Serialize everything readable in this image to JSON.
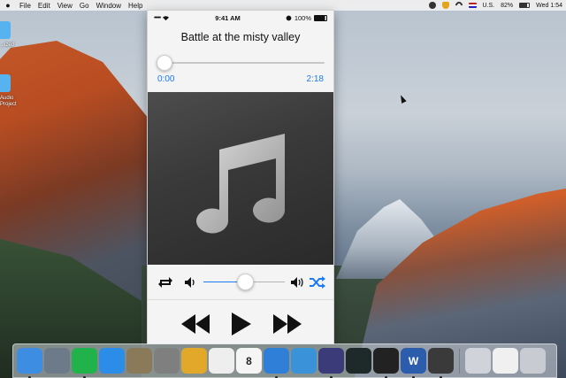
{
  "menubar": {
    "menus": [
      "File",
      "Edit",
      "View",
      "Go",
      "Window",
      "Help"
    ],
    "input_source": "U.S.",
    "battery": "82%",
    "clock": "Wed 1:54"
  },
  "desktop": {
    "icons": [
      {
        "label": "...ized",
        "icon": "folder-icon"
      },
      {
        "label": "Audio\nProject",
        "icon": "folder-icon"
      }
    ]
  },
  "simulator": {
    "status_bar": {
      "signal": "•••••",
      "time": "9:41 AM",
      "battery": "100%"
    },
    "song_title": "Battle at the misty valley",
    "current_time": "0:00",
    "duration": "2:18",
    "progress": 0.0,
    "volume": 0.55,
    "artwork_icon": "music-note-icon"
  },
  "colors": {
    "accent": "#1a7cf2",
    "artwork_bg": "#3a3a3a"
  },
  "dock": {
    "items": [
      {
        "name": "finder-icon",
        "color": "#3d8de3",
        "running": true
      },
      {
        "name": "launchpad-icon",
        "color": "#6c7a8a",
        "running": false
      },
      {
        "name": "pycharm-icon",
        "color": "#21b24b",
        "running": true
      },
      {
        "name": "safari-icon",
        "color": "#2c8de8",
        "running": false
      },
      {
        "name": "gimp-icon",
        "color": "#8a7a5a",
        "running": false
      },
      {
        "name": "calculator-icon",
        "color": "#7f7f7f",
        "running": false
      },
      {
        "name": "wunderlist-icon",
        "color": "#e2a82a",
        "running": false
      },
      {
        "name": "textedit-icon",
        "color": "#eeeeee",
        "running": false
      },
      {
        "name": "calendar-icon",
        "color": "#f5f5f5",
        "running": false
      },
      {
        "name": "xcode-icon",
        "color": "#2f7fd9",
        "running": true
      },
      {
        "name": "preview-icon",
        "color": "#3a92d8",
        "running": false
      },
      {
        "name": "instruments-icon",
        "color": "#3b3b7a",
        "running": true
      },
      {
        "name": "activity-monitor-icon",
        "color": "#1e2a2a",
        "running": false
      },
      {
        "name": "terminal-icon",
        "color": "#222222",
        "running": true
      },
      {
        "name": "word-icon",
        "color": "#2c5dad",
        "running": true
      },
      {
        "name": "quicktime-icon",
        "color": "#3a3a3a",
        "running": true
      },
      {
        "name": "downloads-icon",
        "color": "#d0d4da",
        "running": false
      },
      {
        "name": "document-icon",
        "color": "#f0f0f0",
        "running": false
      },
      {
        "name": "trash-icon",
        "color": "#c8ccd2",
        "running": false
      }
    ],
    "calendar_day": "8",
    "word_letter": "W"
  }
}
